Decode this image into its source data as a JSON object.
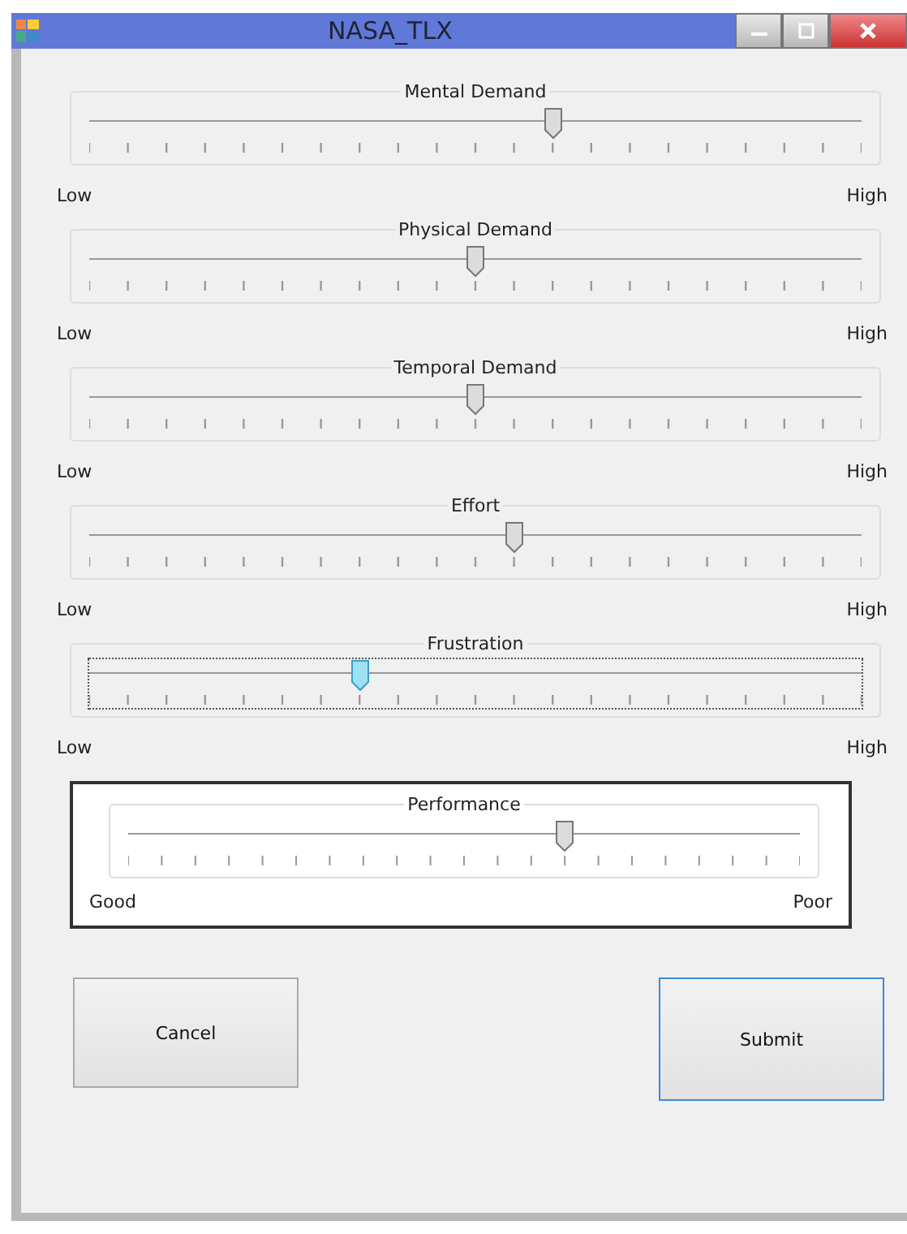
{
  "window": {
    "title": "NASA_TLX"
  },
  "sliders": [
    {
      "kind": "plain",
      "label": "Mental Demand",
      "level": 0.6,
      "focused": false,
      "low": "Low",
      "high": "High"
    },
    {
      "kind": "plain",
      "label": "Physical Demand",
      "level": 0.5,
      "focused": false,
      "low": "Low",
      "high": "High"
    },
    {
      "kind": "plain",
      "label": "Temporal Demand",
      "level": 0.5,
      "focused": false,
      "low": "Low",
      "high": "High"
    },
    {
      "kind": "plain",
      "label": "Effort",
      "level": 0.55,
      "focused": false,
      "low": "Low",
      "high": "High"
    },
    {
      "kind": "plain",
      "label": "Frustration",
      "level": 0.35,
      "focused": true,
      "low": "Low",
      "high": "High"
    },
    {
      "kind": "framed",
      "label": "Performance",
      "level": 0.65,
      "focused": false,
      "low": "Good",
      "high": "Poor"
    }
  ],
  "buttons": [
    {
      "label": "Cancel",
      "default": false
    },
    {
      "label": "Submit",
      "default": true
    }
  ]
}
